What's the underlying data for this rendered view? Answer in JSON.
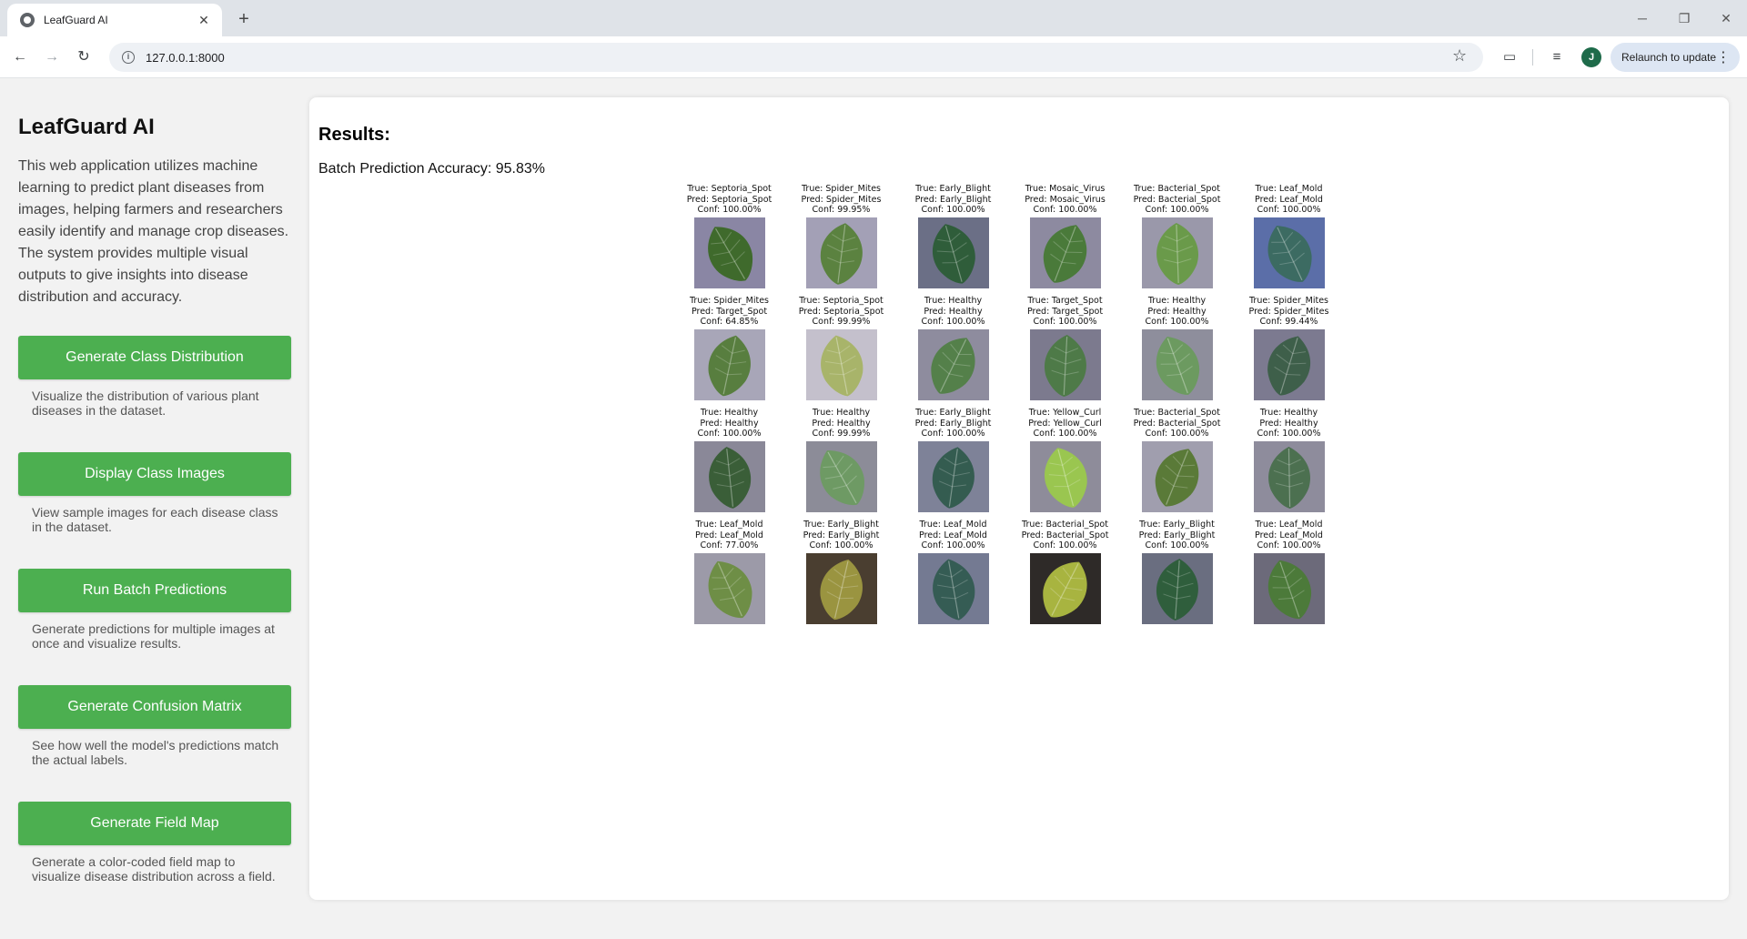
{
  "browser": {
    "tab_title": "LeafGuard AI",
    "url": "127.0.0.1:8000",
    "relaunch_label": "Relaunch to update",
    "profile_initial": "J"
  },
  "sidebar": {
    "title": "LeafGuard AI",
    "description": "This web application utilizes machine learning to predict plant diseases from images, helping farmers and researchers easily identify and manage crop diseases. The system provides multiple visual outputs to give insights into disease distribution and accuracy.",
    "actions": [
      {
        "label": "Generate Class Distribution",
        "desc": "Visualize the distribution of various plant diseases in the dataset."
      },
      {
        "label": "Display Class Images",
        "desc": "View sample images for each disease class in the dataset."
      },
      {
        "label": "Run Batch Predictions",
        "desc": "Generate predictions for multiple images at once and visualize results."
      },
      {
        "label": "Generate Confusion Matrix",
        "desc": "See how well the model's predictions match the actual labels."
      },
      {
        "label": "Generate Field Map",
        "desc": "Generate a color-coded field map to visualize disease distribution across a field."
      }
    ]
  },
  "main": {
    "results_title": "Results:",
    "accuracy_text": "Batch Prediction Accuracy: 95.83%",
    "predictions": [
      {
        "true": "True: Septoria_Spot",
        "pred": "Pred: Septoria_Spot",
        "conf": "Conf: 100.00%",
        "leaf": "#3f6a2c",
        "bg": "#8a86a4"
      },
      {
        "true": "True: Spider_Mites",
        "pred": "Pred: Spider_Mites",
        "conf": "Conf: 99.95%",
        "leaf": "#5b8240",
        "bg": "#a3a0b6"
      },
      {
        "true": "True: Early_Blight",
        "pred": "Pred: Early_Blight",
        "conf": "Conf: 100.00%",
        "leaf": "#2f5d3a",
        "bg": "#6b6f86"
      },
      {
        "true": "True: Mosaic_Virus",
        "pred": "Pred: Mosaic_Virus",
        "conf": "Conf: 100.00%",
        "leaf": "#4a7a3a",
        "bg": "#8d8aa0"
      },
      {
        "true": "True: Bacterial_Spot",
        "pred": "Pred: Bacterial_Spot",
        "conf": "Conf: 100.00%",
        "leaf": "#6a9a4a",
        "bg": "#9a98aa"
      },
      {
        "true": "True: Leaf_Mold",
        "pred": "Pred: Leaf_Mold",
        "conf": "Conf: 100.00%",
        "leaf": "#3c6b62",
        "bg": "#5b6ea8"
      },
      {
        "true": "True: Spider_Mites",
        "pred": "Pred: Target_Spot",
        "conf": "Conf: 64.85%",
        "leaf": "#587e3f",
        "bg": "#a8a6b8"
      },
      {
        "true": "True: Septoria_Spot",
        "pred": "Pred: Septoria_Spot",
        "conf": "Conf: 99.99%",
        "leaf": "#a8b46a",
        "bg": "#c4c0cc"
      },
      {
        "true": "True: Healthy",
        "pred": "Pred: Healthy",
        "conf": "Conf: 100.00%",
        "leaf": "#54804a",
        "bg": "#8e8c9e"
      },
      {
        "true": "True: Target_Spot",
        "pred": "Pred: Target_Spot",
        "conf": "Conf: 100.00%",
        "leaf": "#4e7a48",
        "bg": "#7c7a8e"
      },
      {
        "true": "True: Healthy",
        "pred": "Pred: Healthy",
        "conf": "Conf: 100.00%",
        "leaf": "#6c9a60",
        "bg": "#8e8e9c"
      },
      {
        "true": "True: Spider_Mites",
        "pred": "Pred: Spider_Mites",
        "conf": "Conf: 99.44%",
        "leaf": "#3e5f4a",
        "bg": "#7c7a90"
      },
      {
        "true": "True: Healthy",
        "pred": "Pred: Healthy",
        "conf": "Conf: 100.00%",
        "leaf": "#3a5e38",
        "bg": "#8a8898"
      },
      {
        "true": "True: Healthy",
        "pred": "Pred: Healthy",
        "conf": "Conf: 99.99%",
        "leaf": "#6e9a64",
        "bg": "#8c8c98"
      },
      {
        "true": "True: Early_Blight",
        "pred": "Pred: Early_Blight",
        "conf": "Conf: 100.00%",
        "leaf": "#345c50",
        "bg": "#7e8298"
      },
      {
        "true": "True: Yellow_Curl",
        "pred": "Pred: Yellow_Curl",
        "conf": "Conf: 100.00%",
        "leaf": "#9ac650",
        "bg": "#8e8c9a"
      },
      {
        "true": "True: Bacterial_Spot",
        "pred": "Pred: Bacterial_Spot",
        "conf": "Conf: 100.00%",
        "leaf": "#5a7a38",
        "bg": "#a09eae"
      },
      {
        "true": "True: Healthy",
        "pred": "Pred: Healthy",
        "conf": "Conf: 100.00%",
        "leaf": "#4c7050",
        "bg": "#8e8c9c"
      },
      {
        "true": "True: Leaf_Mold",
        "pred": "Pred: Leaf_Mold",
        "conf": "Conf: 77.00%",
        "leaf": "#6e8e46",
        "bg": "#9c9aa8"
      },
      {
        "true": "True: Early_Blight",
        "pred": "Pred: Early_Blight",
        "conf": "Conf: 100.00%",
        "leaf": "#9a9440",
        "bg": "#4a3e30"
      },
      {
        "true": "True: Leaf_Mold",
        "pred": "Pred: Leaf_Mold",
        "conf": "Conf: 100.00%",
        "leaf": "#355c54",
        "bg": "#747a92"
      },
      {
        "true": "True: Bacterial_Spot",
        "pred": "Pred: Bacterial_Spot",
        "conf": "Conf: 100.00%",
        "leaf": "#a8b440",
        "bg": "#2e2a28"
      },
      {
        "true": "True: Early_Blight",
        "pred": "Pred: Early_Blight",
        "conf": "Conf: 100.00%",
        "leaf": "#2f5e3c",
        "bg": "#6a6e80"
      },
      {
        "true": "True: Leaf_Mold",
        "pred": "Pred: Leaf_Mold",
        "conf": "Conf: 100.00%",
        "leaf": "#4c7a3a",
        "bg": "#6c6a7a"
      }
    ]
  },
  "colors": {
    "accent_green": "#4caf50",
    "panel_bg": "#ffffff",
    "page_bg": "#f2f2f2"
  },
  "icons": [
    "favicon-icon",
    "close-icon",
    "plus-icon",
    "back-arrow-icon",
    "forward-arrow-icon",
    "reload-icon",
    "info-icon",
    "star-icon",
    "cast-icon",
    "media-icon",
    "kebab-menu-icon",
    "minimize-icon",
    "restore-icon",
    "window-close-icon"
  ]
}
